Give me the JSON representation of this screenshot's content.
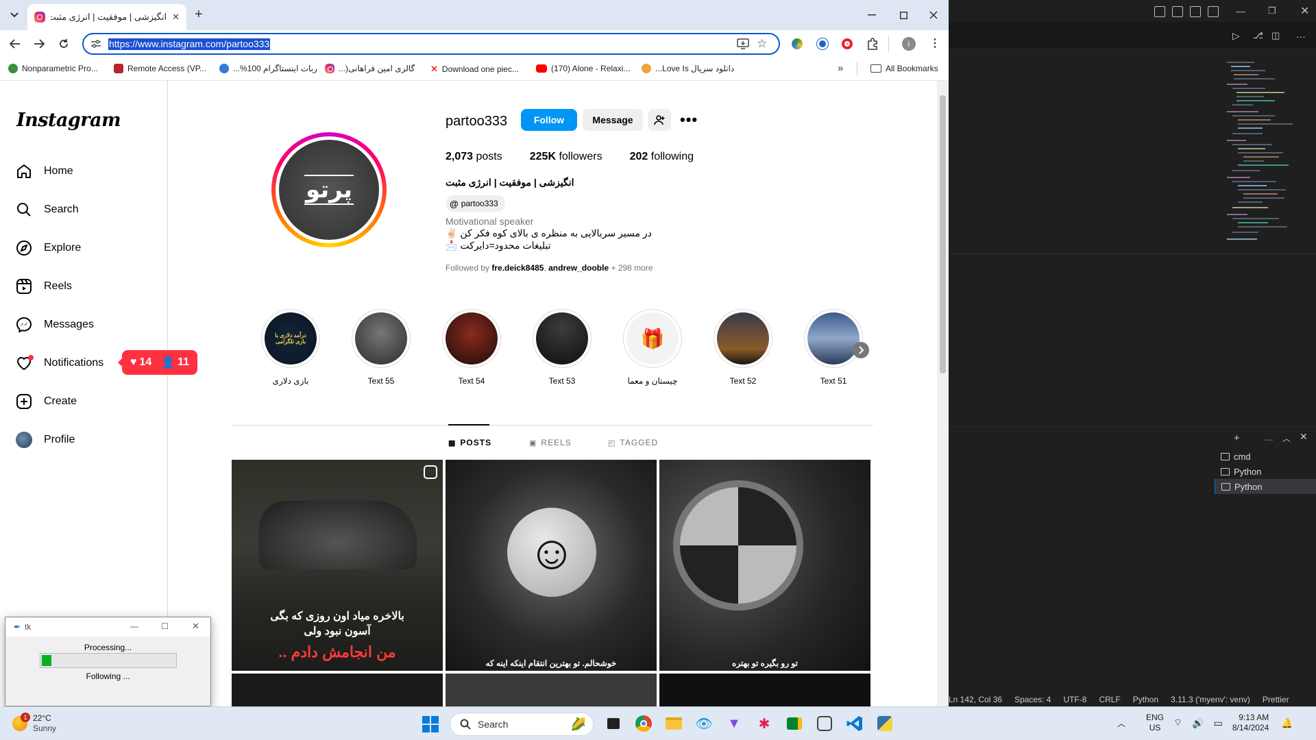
{
  "browser": {
    "tab_title": "انگیزشی | موفقیت | انرژی مثبت (",
    "url": "https://www.instagram.com/partoo333",
    "bookmarks": [
      {
        "label": "Nonparametric Pro...",
        "color": "#3a8f3a"
      },
      {
        "label": "Remote Access (VP...",
        "color": "#b5252a"
      },
      {
        "label": "ربات اینستاگرام 100%...",
        "color": "#2f7bd6"
      },
      {
        "label": "گالری امین فراهانی(...",
        "color": "#e1306c"
      },
      {
        "label": "Download one piec...",
        "color": "#e53935"
      },
      {
        "label": "(170) Alone - Relaxi...",
        "color": "#ff0000"
      },
      {
        "label": "دانلود سریال Love Is...",
        "color": "#f2a33a"
      }
    ],
    "all_bookmarks": "All Bookmarks"
  },
  "sidebar": {
    "logo": "Instagram",
    "items": [
      {
        "label": "Home",
        "icon": "home-icon"
      },
      {
        "label": "Search",
        "icon": "search-icon"
      },
      {
        "label": "Explore",
        "icon": "compass-icon"
      },
      {
        "label": "Reels",
        "icon": "reels-icon"
      },
      {
        "label": "Messages",
        "icon": "messenger-icon"
      },
      {
        "label": "Notifications",
        "icon": "heart-icon"
      },
      {
        "label": "Create",
        "icon": "plus-square-icon"
      },
      {
        "label": "Profile",
        "icon": "avatar-icon"
      }
    ],
    "notif_likes": "14",
    "notif_follows": "11"
  },
  "profile": {
    "username": "partoo333",
    "follow": "Follow",
    "message": "Message",
    "posts_count": "2,073",
    "posts_label": "posts",
    "followers_count": "225K",
    "followers_label": "followers",
    "following_count": "202",
    "following_label": "following",
    "full_name": "انگیزشی | موفقیت | انرژی مثبت",
    "threads": "partoo333",
    "category": "Motivational speaker",
    "bio_line1": "در مسیر سربالایی به منظره ی بالای کوه فکر کن ✌🏻",
    "bio_line2": "تبلیغات محدود=دایرکت 📩",
    "followed_by_prefix": "Followed by",
    "followed_by_user1": "fre.deick8485",
    "followed_by_sep": ",",
    "followed_by_user2": "andrew_dooble",
    "followed_by_more": "+ 298 more",
    "avatar_text": "پرتو"
  },
  "highlights": [
    {
      "label": "بازی دلاری",
      "inner": "درآمد دلاری با بازی تلگرامی"
    },
    {
      "label": "Text 55"
    },
    {
      "label": "Text 54"
    },
    {
      "label": "Text 53"
    },
    {
      "label": "چیستان و معما"
    },
    {
      "label": "Text 52"
    },
    {
      "label": "Text 51"
    }
  ],
  "tabs": {
    "posts": "POSTS",
    "reels": "REELS",
    "tagged": "TAGGED"
  },
  "posts": [
    {
      "cap1": "بالاخره میاد اون روزی که بگی",
      "cap2": "آسون نبود ولی",
      "cap3": "من انجامش دادم .."
    },
    {
      "cap": "خوشحالم. تو بهترین انتقام اینکه اینه که"
    },
    {
      "cap": "تو رو بگیره تو بهتره"
    }
  ],
  "tk": {
    "title": "tk",
    "processing": "Processing...",
    "following": "Following ...",
    "progress": 0.07
  },
  "vscode": {
    "terminals": [
      "cmd",
      "Python",
      "Python"
    ],
    "status": [
      "Ln 142, Col 36",
      "Spaces: 4",
      "UTF-8",
      "CRLF",
      "Python",
      "3.11.3 ('myenv': venv)",
      "Prettier"
    ]
  },
  "taskbar": {
    "temp": "22°C",
    "condition": "Sunny",
    "badge": "1",
    "search": "Search",
    "lang1": "ENG",
    "lang2": "US",
    "time": "9:13 AM",
    "date": "8/14/2024"
  }
}
